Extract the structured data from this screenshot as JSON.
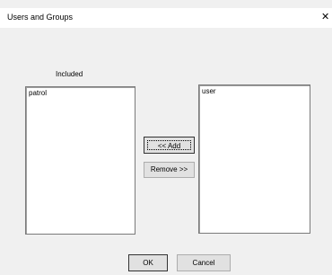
{
  "dialog": {
    "title": "Users and Groups",
    "close_glyph": "✕"
  },
  "included_label": "Included",
  "left_list": {
    "items": [
      "patrol"
    ]
  },
  "right_list": {
    "items": [
      "user"
    ]
  },
  "buttons": {
    "add": "<< Add",
    "remove": "Remove >>",
    "ok": "OK",
    "cancel": "Cancel"
  }
}
